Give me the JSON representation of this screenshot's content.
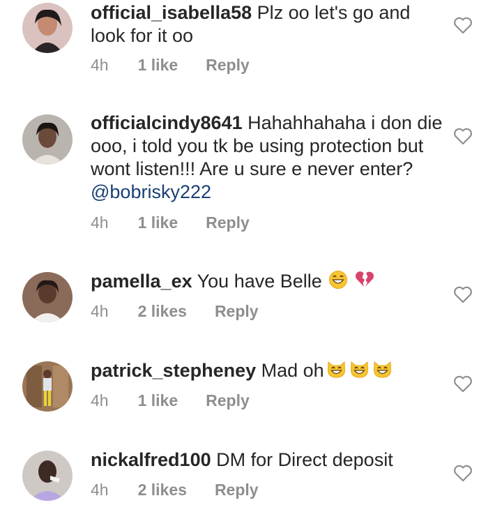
{
  "comments": [
    {
      "username": "official_isabella58",
      "text": "Plz oo let's go and look for it oo",
      "mention": "",
      "time": "4h",
      "likes": "1 like",
      "reply": "Reply",
      "avatar_icon": "profile-photo"
    },
    {
      "username": "officialcindy8641",
      "text": "Hahahhahaha i don die ooo, i told you tk be using protection but wont listen!!! Are u sure e never enter?",
      "mention": "@bobrisky222",
      "time": "4h",
      "likes": "1 like",
      "reply": "Reply",
      "avatar_icon": "profile-photo"
    },
    {
      "username": "pamella_ex",
      "text": "You have Belle",
      "mention": "",
      "emoji": [
        "grinning-face-emoji",
        "broken-heart-emoji"
      ],
      "time": "4h",
      "likes": "2 likes",
      "reply": "Reply",
      "avatar_icon": "profile-photo"
    },
    {
      "username": "patrick_stepheney",
      "text": "Mad oh",
      "mention": "",
      "emoji": [
        "grinning-cat-emoji",
        "grinning-cat-emoji",
        "grinning-cat-emoji"
      ],
      "time": "4h",
      "likes": "1 like",
      "reply": "Reply",
      "avatar_icon": "profile-photo"
    },
    {
      "username": "nickalfred100",
      "text": "DM for Direct deposit",
      "mention": "",
      "time": "4h",
      "likes": "2 likes",
      "reply": "Reply",
      "avatar_icon": "profile-photo"
    }
  ],
  "colors": {
    "text": "#262626",
    "meta": "#8e8e8e",
    "mention": "#1a3f75",
    "heart_outline": "#8e8e8e"
  }
}
